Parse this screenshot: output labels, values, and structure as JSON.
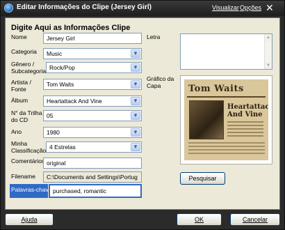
{
  "window": {
    "title": "Editar Informações do Clipe (Jersey Girl)",
    "menu_visualizar": "Visualizar",
    "menu_opcoes": "Opções",
    "close_glyph": "✕"
  },
  "form": {
    "heading": "Digite Aqui as Informações Clipe",
    "nome": {
      "label": "Nome",
      "value": "Jersey Girl"
    },
    "categoria": {
      "label": "Categoria",
      "value": "Music"
    },
    "genero": {
      "label": "Gênero / Subcategoria",
      "value": "Rock/Pop"
    },
    "artista": {
      "label": "Artista / Fonte",
      "value": "Tom Waits"
    },
    "album": {
      "label": "Álbum",
      "value": "Heartattack And Vine"
    },
    "trilha": {
      "label": "N° da Trilha do CD",
      "value": "05"
    },
    "ano": {
      "label": "Ano",
      "value": "1980"
    },
    "classificacao": {
      "label": "Minha Classificação",
      "value": "4 Estrelas"
    },
    "comentarios": {
      "label": "Comentários",
      "value": "original"
    },
    "filename": {
      "label": "Filename",
      "value": "C:\\Documents and Settings\\Portug"
    },
    "palavras": {
      "label": "Palavras-chave",
      "value": "purchased, romantic"
    }
  },
  "right": {
    "letra_label": "Letra",
    "capa_label": "Gráfico da Capa",
    "cover_artist": "Tom Waits",
    "cover_album_line1": "Heartattack",
    "cover_album_line2": "And Vine",
    "pesquisar": "Pesquisar"
  },
  "footer": {
    "ajuda": "Ajuda",
    "ok": "OK",
    "cancelar": "Cancelar"
  },
  "icons": {
    "dropdown": "chevron-down-icon",
    "app": "app-globe-icon"
  },
  "colors": {
    "title_bg": "#1e1e1e",
    "panel_bg": "#ece9d8",
    "highlight": "#316ac5"
  }
}
